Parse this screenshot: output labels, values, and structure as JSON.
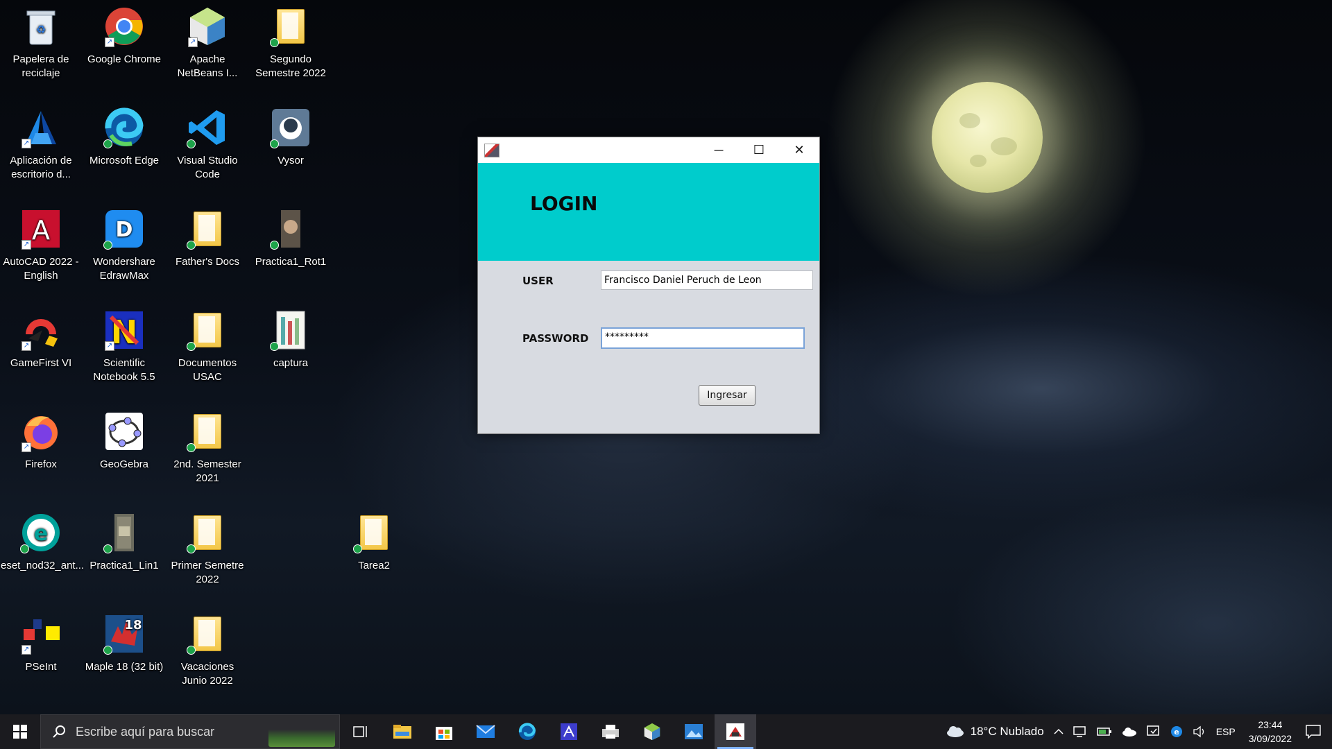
{
  "desktop": {
    "icons": [
      {
        "label": "Papelera de reciclaje",
        "icon": "recycle-bin-icon"
      },
      {
        "label": "Google Chrome",
        "icon": "chrome-icon"
      },
      {
        "label": "Apache NetBeans I...",
        "icon": "netbeans-icon"
      },
      {
        "label": "Segundo Semestre 2022",
        "icon": "folder-icon"
      },
      {
        "label": "Aplicación de escritorio d...",
        "icon": "azure-icon"
      },
      {
        "label": "Microsoft Edge",
        "icon": "edge-icon"
      },
      {
        "label": "Visual Studio Code",
        "icon": "vscode-icon"
      },
      {
        "label": "Vysor",
        "icon": "vysor-icon"
      },
      {
        "label": "AutoCAD 2022 - English",
        "icon": "autocad-icon"
      },
      {
        "label": "Wondershare EdrawMax",
        "icon": "edrawmax-icon"
      },
      {
        "label": "Father's Docs",
        "icon": "folder-icon"
      },
      {
        "label": "Practica1_Rot1",
        "icon": "image-file-icon"
      },
      {
        "label": "GameFirst VI",
        "icon": "gamefirst-icon"
      },
      {
        "label": "Scientific Notebook 5.5",
        "icon": "scientific-notebook-icon"
      },
      {
        "label": "Documentos USAC",
        "icon": "folder-icon"
      },
      {
        "label": "captura",
        "icon": "image-file-icon"
      },
      {
        "label": "Firefox",
        "icon": "firefox-icon"
      },
      {
        "label": "GeoGebra",
        "icon": "geogebra-icon"
      },
      {
        "label": "2nd. Semester 2021",
        "icon": "folder-icon"
      },
      {
        "label": "eset_nod32_ant...",
        "icon": "eset-icon"
      },
      {
        "label": "Practica1_Lin1",
        "icon": "image-file-icon"
      },
      {
        "label": "Primer Semetre 2022",
        "icon": "folder-icon"
      },
      {
        "label": "Tarea2",
        "icon": "folder-icon"
      },
      {
        "label": "PSeInt",
        "icon": "pseint-icon"
      },
      {
        "label": "Maple 18 (32 bit)",
        "icon": "maple-icon"
      },
      {
        "label": "Vacaciones Junio 2022",
        "icon": "folder-icon"
      }
    ]
  },
  "login_window": {
    "title_icon": "java-app-icon",
    "minimize": "─",
    "maximize": "☐",
    "close": "✕",
    "heading": "LOGIN",
    "user_label": "USER",
    "user_value": "Francisco Daniel Peruch de Leon",
    "password_label": "PASSWORD",
    "password_value": "*********",
    "submit_label": "Ingresar",
    "header_color": "#00CCCC"
  },
  "taskbar": {
    "search_placeholder": "Escribe aquí para buscar",
    "apps": [
      "task-view-icon",
      "file-explorer-icon",
      "microsoft-store-icon",
      "mail-icon",
      "edge-icon",
      "visual-studio-icon",
      "printer-icon",
      "netbeans-icon",
      "photos-icon",
      "java-app-icon"
    ],
    "weather": "18°C  Nublado",
    "language": "ESP",
    "time": "23:44",
    "date": "3/09/2022"
  }
}
